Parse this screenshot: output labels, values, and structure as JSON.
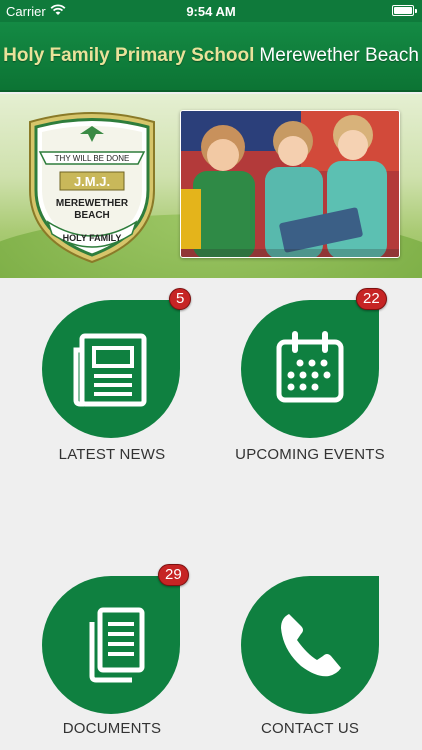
{
  "status_bar": {
    "carrier": "Carrier",
    "time": "9:54 AM"
  },
  "header": {
    "title_bold": "Holy Family Primary School",
    "title_light": "Merewether Beach"
  },
  "banner": {
    "crest": {
      "motto": "THY WILL BE DONE",
      "initials": "J.M.J.",
      "line1": "MEREWETHER",
      "line2": "BEACH",
      "scroll": "HOLY FAMILY"
    }
  },
  "tiles": [
    {
      "label": "LATEST NEWS",
      "badge": "5",
      "icon": "newspaper-icon"
    },
    {
      "label": "UPCOMING EVENTS",
      "badge": "22",
      "icon": "calendar-icon"
    },
    {
      "label": "DOCUMENTS",
      "badge": "29",
      "icon": "documents-icon"
    },
    {
      "label": "CONTACT US",
      "badge": "",
      "icon": "phone-icon"
    }
  ],
  "colors": {
    "brand_green": "#0f8040",
    "header_gold": "#e9e29a",
    "badge_red": "#c62424"
  }
}
